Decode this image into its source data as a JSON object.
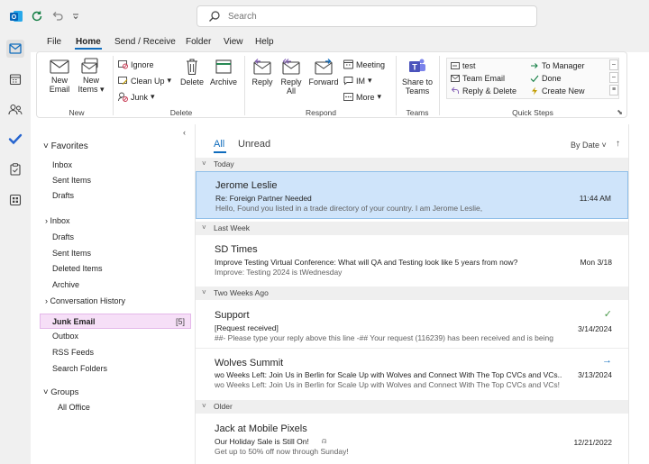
{
  "search": {
    "placeholder": "Search"
  },
  "menu": {
    "items": [
      "File",
      "Home",
      "Send / Receive",
      "Folder",
      "View",
      "Help"
    ]
  },
  "ribbon": {
    "new_email": [
      "New",
      "Email"
    ],
    "new_items": [
      "New",
      "Items"
    ],
    "ignore": "Ignore",
    "clean_up": "Clean Up",
    "junk": "Junk",
    "delete": "Delete",
    "archive": "Archive",
    "reply": "Reply",
    "reply_all": [
      "Reply",
      "All"
    ],
    "forward": "Forward",
    "meeting": "Meeting",
    "im": "IM",
    "more": "More",
    "share_teams": [
      "Share to",
      "Teams"
    ],
    "groups": {
      "new": "New",
      "delete": "Delete",
      "respond": "Respond",
      "teams": "Teams",
      "quick_steps": "Quick Steps"
    },
    "quick_steps": [
      "test",
      "Team Email",
      "Reply & Delete",
      "To Manager",
      "Done",
      "Create New"
    ]
  },
  "folders": {
    "favorites_label": "Favorites",
    "favorites": [
      "Inbox",
      "Sent Items",
      "Drafts"
    ],
    "inbox": "Inbox",
    "main": [
      "Drafts",
      "Sent Items",
      "Deleted Items",
      "Archive"
    ],
    "conversation_history": "Conversation History",
    "junk": "Junk Email",
    "junk_count": "[5]",
    "after": [
      "Outbox",
      "RSS Feeds",
      "Search Folders"
    ],
    "groups_label": "Groups",
    "groups": [
      "All Office"
    ]
  },
  "list": {
    "tab_all": "All",
    "tab_unread": "Unread",
    "sort": "By Date",
    "sections": [
      "Today",
      "Last Week",
      "Two Weeks Ago",
      "Older"
    ],
    "emails": [
      {
        "sender": "Jerome Leslie",
        "subject": "Re: Foreign Partner Needed",
        "preview": "Hello,  Found you listed in a trade directory of your country. I am Jerome Leslie,",
        "date": "11:44 AM"
      },
      {
        "sender": "SD Times",
        "subject": "Improve Testing Virtual Conference: What will QA and Testing look like 5 years from now?",
        "preview": "Improve: Testing 2024 is tWednesday",
        "date": "Mon 3/18"
      },
      {
        "sender": "Support",
        "subject": "[Request received]",
        "preview": "##- Please type your reply above this line -##  Your request (116239) has been received and is being",
        "date": "3/14/2024"
      },
      {
        "sender": "Wolves Summit",
        "subject": "wo Weeks Left: Join Us in Berlin for Scale Up with Wolves and Connect With The Top CVCs and VCs...",
        "preview": "wo Weeks Left: Join Us in Berlin for Scale Up with Wolves and Connect With The Top CVCs and VCs!",
        "date": "3/13/2024"
      },
      {
        "sender": "Jack at Mobile Pixels",
        "subject": "Our Holiday Sale is Still On!",
        "preview": "Get up to 50% off now through Sunday!",
        "date": "12/21/2022"
      }
    ]
  },
  "colors": {
    "accent": "#0f6cbd",
    "selected": "#cfe4fa",
    "junk_highlight": "#f6dff7"
  }
}
